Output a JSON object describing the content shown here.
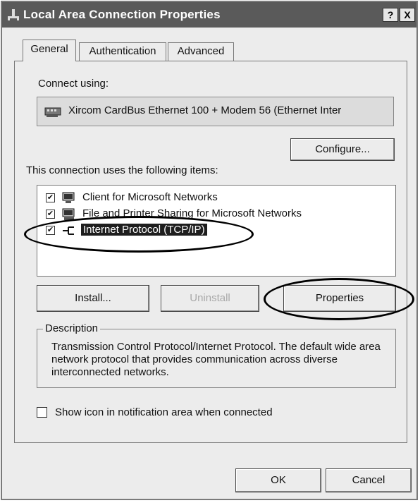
{
  "window": {
    "title": "Local Area Connection Properties",
    "help_label": "?",
    "close_label": "X"
  },
  "tabs": [
    {
      "label": "General"
    },
    {
      "label": "Authentication"
    },
    {
      "label": "Advanced"
    }
  ],
  "connect_using": {
    "label": "Connect using:",
    "adapter": "Xircom CardBus Ethernet 100 + Modem 56 (Ethernet Inter",
    "configure_label": "Configure..."
  },
  "items": {
    "label": "This connection uses the following items:",
    "list": [
      {
        "label": "Client for Microsoft Networks",
        "checked": true,
        "icon": "network-client-icon"
      },
      {
        "label": "File and Printer Sharing for Microsoft Networks",
        "checked": true,
        "icon": "file-printer-sharing-icon"
      },
      {
        "label": "Internet Protocol (TCP/IP)",
        "checked": true,
        "icon": "protocol-icon",
        "selected": true
      }
    ]
  },
  "buttons": {
    "install": "Install...",
    "uninstall": "Uninstall",
    "properties": "Properties",
    "ok": "OK",
    "cancel": "Cancel"
  },
  "description": {
    "title": "Description",
    "text": "Transmission Control Protocol/Internet Protocol. The default wide area network protocol that provides communication across diverse interconnected networks."
  },
  "notification": {
    "label": "Show icon in notification area when connected",
    "checked": false
  }
}
